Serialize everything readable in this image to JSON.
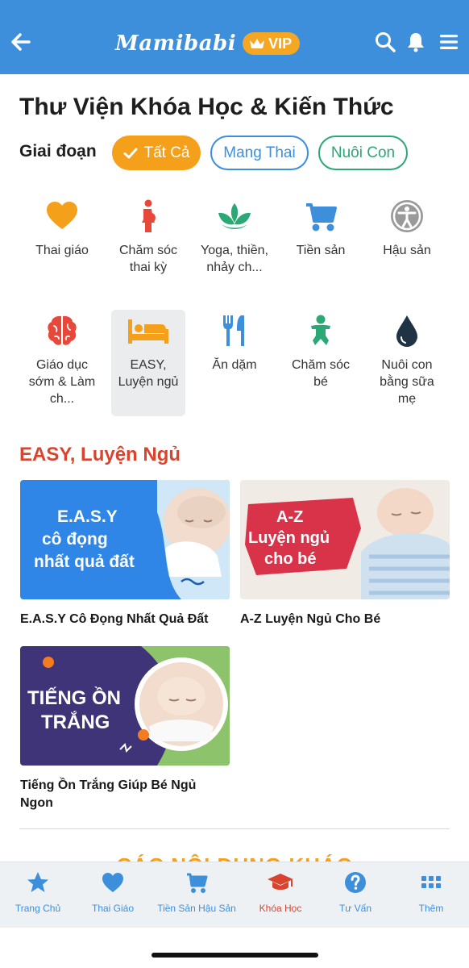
{
  "header": {
    "back_icon": "arrow-left-icon",
    "logo": "Mamibabi",
    "vip_label": "VIP",
    "icons": [
      "search-icon",
      "bell-icon",
      "menu-icon"
    ],
    "bg_color": "#3d8fdc",
    "vip_color": "#f5a623"
  },
  "page": {
    "title": "Thư Viện Khóa Học & Kiến Thức",
    "stage_label": "Giai đoạn"
  },
  "filters": [
    {
      "label": "Tất Cả",
      "selected": true,
      "color": "#f5a01a"
    },
    {
      "label": "Mang Thai",
      "selected": false,
      "color": "#3d8fdc"
    },
    {
      "label": "Nuôi Con",
      "selected": false,
      "color": "#2aa876"
    }
  ],
  "categories": [
    {
      "label": "Thai giáo",
      "icon": "heart-icon",
      "active": false
    },
    {
      "label": "Chăm sóc thai kỳ",
      "icon": "pregnant-woman-icon",
      "active": false
    },
    {
      "label": "Yoga, thiền, nhảy ch...",
      "icon": "lotus-icon",
      "active": false
    },
    {
      "label": "Tiền sản",
      "icon": "stroller-icon",
      "active": false
    },
    {
      "label": "Hậu sản",
      "icon": "accessibility-icon",
      "active": false
    },
    {
      "label": "Giáo dục sớm & Làm ch...",
      "icon": "brain-icon",
      "active": false
    },
    {
      "label": "EASY, Luyện ngủ",
      "icon": "bed-icon",
      "active": true
    },
    {
      "label": "Ăn dặm",
      "icon": "cutlery-icon",
      "active": false
    },
    {
      "label": "Chăm sóc bé",
      "icon": "baby-icon",
      "active": false
    },
    {
      "label": "Nuôi con bằng sữa mẹ",
      "icon": "milk-drop-icon",
      "active": false
    }
  ],
  "section": {
    "title": "EASY, Luyện Ngủ",
    "courses": [
      {
        "title": "E.A.S.Y Cô Đọng Nhất Quả Đất",
        "thumb_text": [
          "E.A.S.Y",
          "cô đọng",
          "nhất quả đất"
        ]
      },
      {
        "title": "A-Z Luyện Ngủ Cho Bé",
        "thumb_text": [
          "A-Z",
          "Luyện ngủ",
          "cho bé"
        ]
      },
      {
        "title": "Tiếng Ồn Trắng Giúp Bé Ngủ Ngon",
        "thumb_text": [
          "TIẾNG ỒN",
          "TRẮNG"
        ]
      }
    ]
  },
  "other_section_title": "CÁC NỘI DUNG KHÁC",
  "bottom_nav": [
    {
      "label": "Trang Chủ",
      "icon": "star-icon",
      "active": false
    },
    {
      "label": "Thai Giáo",
      "icon": "heart-icon",
      "active": false
    },
    {
      "label": "Tiền Sản Hậu Sản",
      "icon": "stroller-icon",
      "active": false
    },
    {
      "label": "Khóa Học",
      "icon": "graduation-cap-icon",
      "active": true
    },
    {
      "label": "Tư Vấn",
      "icon": "help-circle-icon",
      "active": false
    },
    {
      "label": "Thêm",
      "icon": "grid-icon",
      "active": false
    }
  ]
}
